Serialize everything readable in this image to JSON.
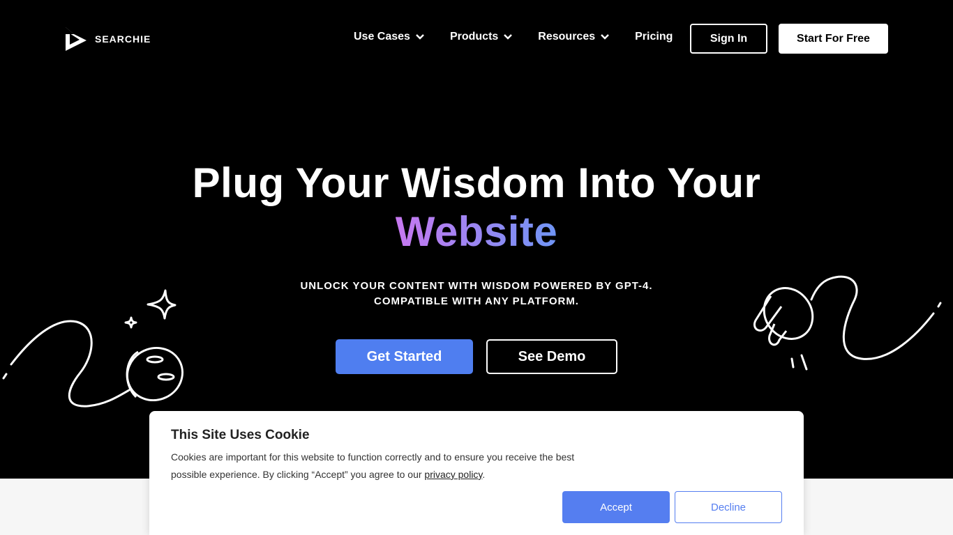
{
  "brand": {
    "name": "SEARCHIE"
  },
  "nav": {
    "items": [
      {
        "label": "Use Cases",
        "has_dropdown": true
      },
      {
        "label": "Products",
        "has_dropdown": true
      },
      {
        "label": "Resources",
        "has_dropdown": true
      },
      {
        "label": "Pricing",
        "has_dropdown": false
      }
    ],
    "sign_in": "Sign In",
    "start_free": "Start For Free"
  },
  "hero": {
    "title_line1": "Plug Your Wisdom Into Your",
    "title_line2": "Website",
    "subtitle_line1": "UNLOCK YOUR CONTENT WITH WISDOM POWERED BY GPT-4.",
    "subtitle_line2": "COMPATIBLE WITH ANY PLATFORM.",
    "primary_cta": "Get Started",
    "secondary_cta": "See Demo"
  },
  "cookie": {
    "title": "This Site Uses Cookie",
    "text_before": "Cookies are important for this website to function correctly and to ensure you receive the best possible experience. By clicking “Accept” you agree to our ",
    "link": "privacy policy",
    "text_after": ".",
    "accept": "Accept",
    "decline": "Decline"
  },
  "colors": {
    "background": "#000000",
    "accent_blue": "#4f7ef0",
    "gradient_start": "#c778f0",
    "gradient_end": "#6f95f5"
  },
  "icons": [
    "searchie-logo-icon",
    "chevron-down-icon",
    "sparkle-icon",
    "plug-socket-icon",
    "plug-icon"
  ]
}
